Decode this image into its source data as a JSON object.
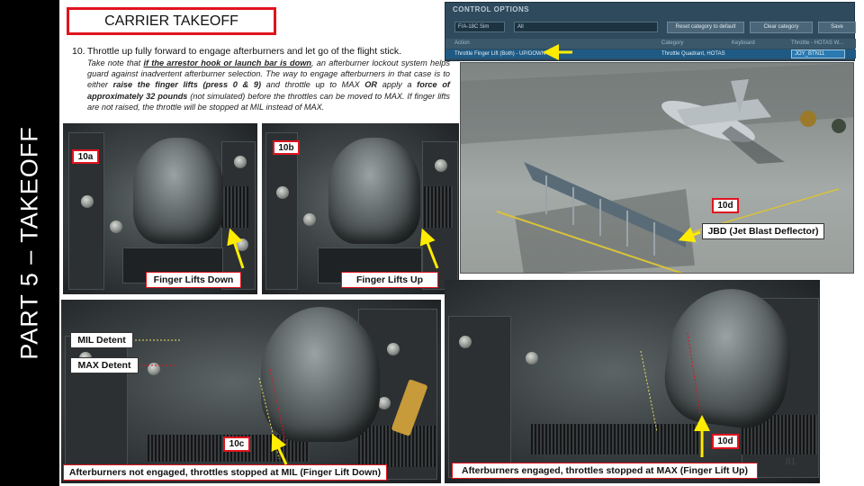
{
  "side_title": "PART 5 – TAKEOFF",
  "title": "CARRIER TAKEOFF",
  "step": {
    "number": "10.",
    "heading": "Throttle up fully forward to engage afterburners and let go of the flight stick.",
    "body_parts": {
      "p1": "Take note that ",
      "p2": "if the arrestor hook or launch bar is down",
      "p3": ", an afterburner lockout system helps guard against inadvertent afterburner selection. The way to engage afterburners in that case is to either ",
      "p4": "raise the finger lifts (press 0 & 9)",
      "p5": " and throttle up to MAX ",
      "p6": "OR",
      "p7": " apply a ",
      "p8": "force of approximately 32 pounds",
      "p9": " (not simulated) before the throttles can be moved to MAX. If finger lifts are not raised, the throttle will be stopped at MIL instead of MAX."
    }
  },
  "control_options": {
    "title": "CONTROL OPTIONS",
    "aircraft_select": "F/A-18C Sim",
    "category_select": "All",
    "reset_button": "Reset category to default",
    "clear_button": "Clear category",
    "save_button": "Save",
    "columns": {
      "action": "Action",
      "category": "Category",
      "keyboard": "Keyboard",
      "throttle": "Throttle - HOTAS W..."
    },
    "row": {
      "action": "Throttle Finger Lift (Both) - UP/DOWN",
      "category": "Throttle Quadrant, HOTAS",
      "binding": "JOY_BTN11"
    }
  },
  "panels": {
    "a": {
      "tag": "10a",
      "caption": "Finger Lifts Down"
    },
    "b": {
      "tag": "10b",
      "caption": "Finger Lifts Up"
    },
    "d": {
      "tag": "10d",
      "caption": "JBD (Jet Blast Deflector)"
    },
    "c": {
      "tag": "10c",
      "caption": "Afterburners not engaged, throttles stopped at MIL (Finger Lift Down)",
      "mil_label": "MIL Detent",
      "max_label": "MAX Detent"
    },
    "e": {
      "tag": "10d",
      "caption": "Afterburners engaged, throttles stopped at MAX (Finger Lift Up)"
    }
  },
  "page_number": "81",
  "colors": {
    "accent_red": "#e0141e",
    "arrow_yellow": "#ffec00",
    "band": "#000000"
  }
}
